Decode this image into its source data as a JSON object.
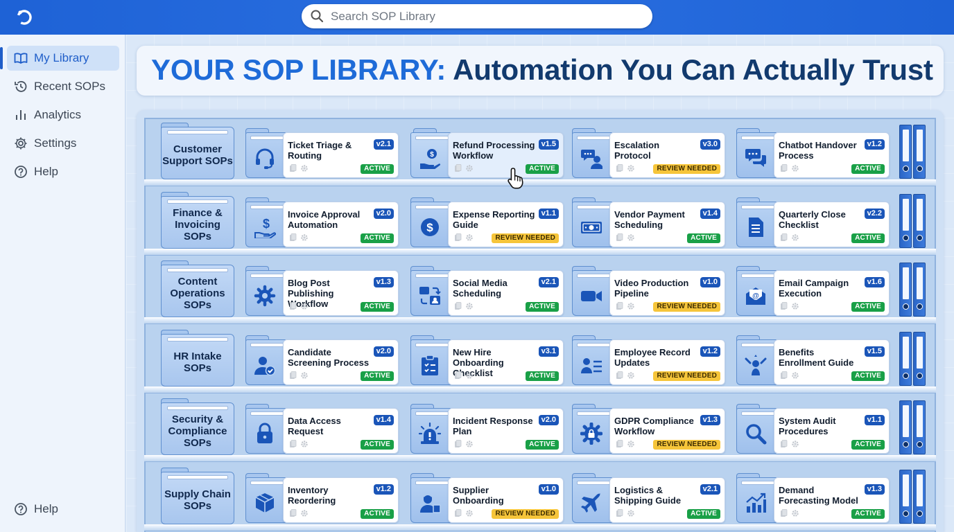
{
  "app": {
    "logo_icon": "app-logo-icon"
  },
  "search": {
    "placeholder": "Search SOP Library"
  },
  "sidebar": {
    "items": [
      {
        "label": "My Library",
        "icon": "book-icon",
        "active": true
      },
      {
        "label": "Recent SOPs",
        "icon": "history-icon"
      },
      {
        "label": "Analytics",
        "icon": "bar-chart-icon"
      },
      {
        "label": "Settings",
        "icon": "gear-icon"
      },
      {
        "label": "Help",
        "icon": "help-icon"
      }
    ],
    "footer_help": "Help"
  },
  "banner": {
    "title_accent": "YOUR SOP LIBRARY:",
    "title_rest": " Automation You Can Actually Trust"
  },
  "colors": {
    "accent": "#1e6bd8",
    "active": "#19a047",
    "review": "#f6c53a",
    "version_badge": "#1a55b8"
  },
  "shelves": [
    {
      "category": "Customer Support SOPs",
      "cards": [
        {
          "title": "Ticket Triage & Routing",
          "version": "v2.1",
          "status": "ACTIVE",
          "icon": "headset-icon"
        },
        {
          "title": "Refund Processing Workflow",
          "version": "v1.5",
          "status": "ACTIVE",
          "icon": "refund-hand-icon",
          "highlighted": true
        },
        {
          "title": "Escalation Protocol",
          "version": "v3.0",
          "status": "REVIEW NEEDED",
          "icon": "chat-user-icon"
        },
        {
          "title": "Chatbot Handover Process",
          "version": "v1.2",
          "status": "ACTIVE",
          "icon": "chat-bubbles-icon"
        }
      ]
    },
    {
      "category": "Finance & Invoicing SOPs",
      "cards": [
        {
          "title": "Invoice Approval Automation",
          "version": "v2.0",
          "status": "ACTIVE",
          "icon": "dollar-hand-icon"
        },
        {
          "title": "Expense Reporting Guide",
          "version": "v1.1",
          "status": "REVIEW NEEDED",
          "icon": "dollar-coin-icon"
        },
        {
          "title": "Vendor Payment Scheduling",
          "version": "v1.4",
          "status": "ACTIVE",
          "icon": "banknote-icon"
        },
        {
          "title": "Quarterly Close Checklist",
          "version": "v2.2",
          "status": "ACTIVE",
          "icon": "document-list-icon"
        }
      ]
    },
    {
      "category": "Content Operations SOPs",
      "cards": [
        {
          "title": "Blog Post Publishing Workflow",
          "version": "v1.3",
          "status": "ACTIVE",
          "icon": "gear-icon"
        },
        {
          "title": "Social Media Scheduling",
          "version": "v2.1",
          "status": "ACTIVE",
          "icon": "social-share-icon"
        },
        {
          "title": "Video Production Pipeline",
          "version": "v1.0",
          "status": "REVIEW NEEDED",
          "icon": "video-camera-icon"
        },
        {
          "title": "Email Campaign Execution",
          "version": "v1.6",
          "status": "ACTIVE",
          "icon": "email-icon"
        }
      ]
    },
    {
      "category": "HR Intake SOPs",
      "cards": [
        {
          "title": "Candidate Screening Process",
          "version": "v2.0",
          "status": "ACTIVE",
          "icon": "user-check-icon"
        },
        {
          "title": "New Hire Onboarding Checklist",
          "version": "v3.1",
          "status": "ACTIVE",
          "icon": "clipboard-icon"
        },
        {
          "title": "Employee Record Updates",
          "version": "v1.2",
          "status": "REVIEW NEEDED",
          "icon": "user-list-icon"
        },
        {
          "title": "Benefits Enrollment Guide",
          "version": "v1.5",
          "status": "ACTIVE",
          "icon": "benefits-icon"
        }
      ]
    },
    {
      "category": "Security & Compliance SOPs",
      "cards": [
        {
          "title": "Data Access Request",
          "version": "v1.4",
          "status": "ACTIVE",
          "icon": "lock-icon"
        },
        {
          "title": "Incident Response Plan",
          "version": "v2.0",
          "status": "ACTIVE",
          "icon": "alarm-icon"
        },
        {
          "title": "GDPR Compliance Workflow",
          "version": "v1.3",
          "status": "REVIEW NEEDED",
          "icon": "gear-lock-icon"
        },
        {
          "title": "System Audit Procedures",
          "version": "v1.1",
          "status": "ACTIVE",
          "icon": "magnifier-icon"
        }
      ]
    },
    {
      "category": "Supply Chain SOPs",
      "cards": [
        {
          "title": "Inventory Reordering",
          "version": "v1.2",
          "status": "ACTIVE",
          "icon": "box-icon"
        },
        {
          "title": "Supplier Onboarding",
          "version": "v1.0",
          "status": "REVIEW NEEDED",
          "icon": "supplier-icon"
        },
        {
          "title": "Logistics & Shipping Guide",
          "version": "v2.1",
          "status": "ACTIVE",
          "icon": "airplane-icon"
        },
        {
          "title": "Demand Forecasting Model",
          "version": "v1.3",
          "status": "ACTIVE",
          "icon": "growth-chart-icon"
        }
      ]
    }
  ]
}
